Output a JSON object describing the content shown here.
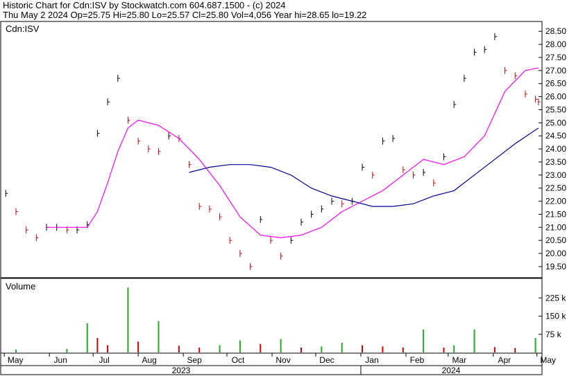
{
  "header": {
    "line1": "Historic Chart for Cdn:ISV by Stockwatch.com 604.687.1500 - (c) 2024",
    "line2": "Thu May  2 2024   Op=25.75   Hi=25.80   Lo=25.57   Cl=25.80   Vol=4,056   Year hi=28.65   lo=19.22"
  },
  "colors": {
    "up": "#000000",
    "down": "#cc0000",
    "ma_short": "#ff00ff",
    "ma_long": "#000099",
    "vol_up": "#22aa22",
    "vol_down": "#cc0000",
    "axis": "#000000",
    "grid": "#dcdcdc"
  },
  "chart_data": [
    {
      "type": "line",
      "panel_label": "Cdn:ISV",
      "y_ticks": [
        "28.50",
        "28.00",
        "27.50",
        "27.00",
        "26.50",
        "26.00",
        "25.50",
        "25.00",
        "24.50",
        "24.00",
        "23.50",
        "23.00",
        "22.50",
        "22.00",
        "21.50",
        "21.00",
        "20.50",
        "20.00",
        "19.50"
      ],
      "ylim": [
        19.1,
        28.85
      ],
      "x_months": [
        "May",
        "Jun",
        "Jul",
        "Aug",
        "Sep",
        "Oct",
        "Nov",
        "Dec",
        "Jan",
        "Feb",
        "Mar",
        "Apr",
        "May"
      ],
      "x_years": [
        "2023",
        "2024"
      ],
      "series": [
        {
          "kind": "price",
          "dates": [
            "2023-05-02",
            "2023-05-09",
            "2023-05-16",
            "2023-05-23",
            "2023-05-30",
            "2023-06-06",
            "2023-06-13",
            "2023-06-20",
            "2023-06-27",
            "2023-07-04",
            "2023-07-11",
            "2023-07-18",
            "2023-07-25",
            "2023-08-01",
            "2023-08-08",
            "2023-08-15",
            "2023-08-22",
            "2023-08-29",
            "2023-09-05",
            "2023-09-12",
            "2023-09-19",
            "2023-09-26",
            "2023-10-03",
            "2023-10-10",
            "2023-10-17",
            "2023-10-24",
            "2023-10-31",
            "2023-11-07",
            "2023-11-14",
            "2023-11-21",
            "2023-11-28",
            "2023-12-05",
            "2023-12-12",
            "2023-12-19",
            "2023-12-26",
            "2024-01-02",
            "2024-01-09",
            "2024-01-16",
            "2024-01-23",
            "2024-01-30",
            "2024-02-06",
            "2024-02-13",
            "2024-02-20",
            "2024-02-27",
            "2024-03-05",
            "2024-03-12",
            "2024-03-19",
            "2024-03-26",
            "2024-04-02",
            "2024-04-09",
            "2024-04-16",
            "2024-04-23",
            "2024-04-30",
            "2024-05-02"
          ],
          "values": [
            22.3,
            21.6,
            20.9,
            20.6,
            21.0,
            21.0,
            20.9,
            20.9,
            21.1,
            24.6,
            25.8,
            26.7,
            25.1,
            24.3,
            24.0,
            23.9,
            24.5,
            24.4,
            23.4,
            21.8,
            21.7,
            21.4,
            20.5,
            20.0,
            19.5,
            21.3,
            20.5,
            19.9,
            20.5,
            21.2,
            21.5,
            21.7,
            22.0,
            21.9,
            22.0,
            23.3,
            23.0,
            24.3,
            24.4,
            23.2,
            23.0,
            23.1,
            22.7,
            23.7,
            25.7,
            26.7,
            27.7,
            27.8,
            28.3,
            27.0,
            26.8,
            26.1,
            25.9,
            25.8
          ]
        },
        {
          "name": "",
          "kind": "ma_short",
          "dates": [
            "2023-05-30",
            "2023-06-13",
            "2023-06-27",
            "2023-07-04",
            "2023-07-11",
            "2023-07-18",
            "2023-07-25",
            "2023-08-01",
            "2023-08-15",
            "2023-08-29",
            "2023-09-12",
            "2023-09-26",
            "2023-10-10",
            "2023-10-24",
            "2023-11-07",
            "2023-11-21",
            "2023-12-05",
            "2023-12-19",
            "2024-01-02",
            "2024-01-16",
            "2024-01-30",
            "2024-02-13",
            "2024-02-27",
            "2024-03-12",
            "2024-03-26",
            "2024-04-09",
            "2024-04-23",
            "2024-05-02"
          ],
          "values": [
            21.0,
            21.0,
            21.0,
            21.6,
            22.7,
            23.9,
            24.8,
            25.1,
            24.9,
            24.4,
            23.6,
            22.6,
            21.4,
            20.7,
            20.6,
            20.7,
            21.0,
            21.6,
            22.0,
            22.4,
            23.0,
            23.6,
            23.4,
            23.7,
            24.5,
            26.2,
            27.0,
            27.1
          ]
        },
        {
          "name": "",
          "kind": "ma_long",
          "dates": [
            "2023-09-05",
            "2023-09-19",
            "2023-10-03",
            "2023-10-17",
            "2023-10-31",
            "2023-11-14",
            "2023-11-28",
            "2023-12-12",
            "2023-12-26",
            "2024-01-09",
            "2024-01-23",
            "2024-02-06",
            "2024-02-20",
            "2024-03-05",
            "2024-03-19",
            "2024-04-02",
            "2024-04-16",
            "2024-05-02"
          ],
          "values": [
            23.1,
            23.3,
            23.4,
            23.4,
            23.3,
            23.0,
            22.5,
            22.2,
            22.0,
            21.8,
            21.8,
            21.9,
            22.2,
            22.4,
            23.0,
            23.6,
            24.2,
            24.8
          ]
        }
      ]
    },
    {
      "type": "bar",
      "panel_label": "Volume",
      "y_ticks": [
        "225 k",
        "150 k",
        "75 k"
      ],
      "ylim": [
        0,
        300000
      ],
      "dates": [
        "2023-05-09",
        "2023-06-13",
        "2023-06-27",
        "2023-07-04",
        "2023-07-11",
        "2023-07-25",
        "2023-08-01",
        "2023-08-15",
        "2023-08-29",
        "2023-09-12",
        "2023-09-26",
        "2023-10-10",
        "2023-10-24",
        "2023-11-07",
        "2023-11-21",
        "2023-12-05",
        "2023-12-19",
        "2024-01-02",
        "2024-01-16",
        "2024-01-30",
        "2024-02-13",
        "2024-02-27",
        "2024-03-05",
        "2024-03-19",
        "2024-04-02",
        "2024-04-16",
        "2024-04-30"
      ],
      "values": [
        12000,
        15000,
        120000,
        60000,
        30000,
        268000,
        45000,
        130000,
        28000,
        20000,
        30000,
        50000,
        35000,
        55000,
        20000,
        25000,
        40000,
        30000,
        25000,
        20000,
        95000,
        20000,
        30000,
        95000,
        22000,
        18000,
        60000
      ]
    }
  ]
}
